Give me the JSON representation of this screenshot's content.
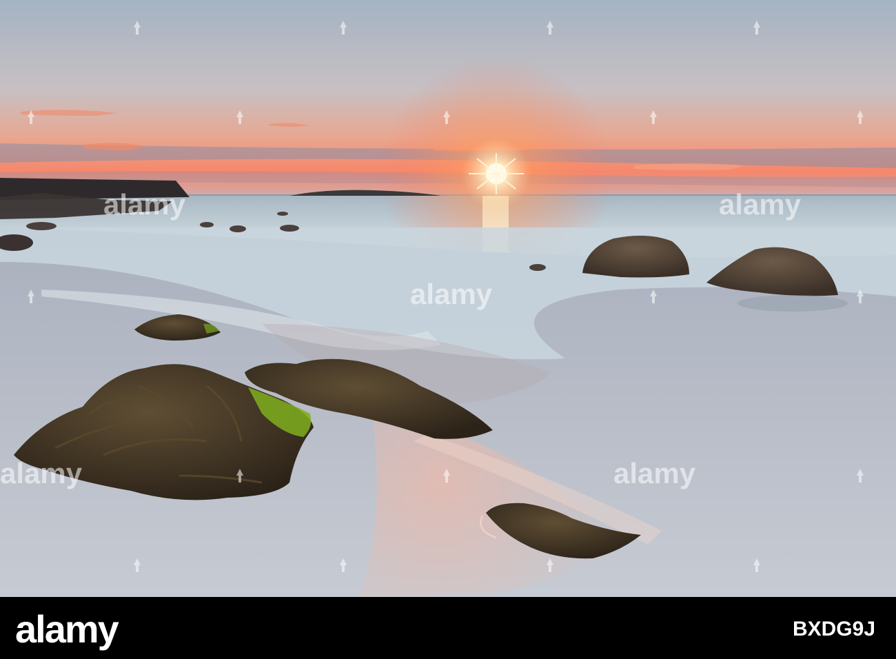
{
  "watermark": {
    "brand": "alamy",
    "mark_color": "#ffffff",
    "mark_opacity": 0.55
  },
  "footer": {
    "brand": "alamy",
    "image_id": "BXDG9J",
    "bg_color": "#000000",
    "text_color": "#ffffff"
  },
  "scene": {
    "subject": "sunset over sandy beach with seaweed-covered rocks",
    "sky_top": "#a7b7c6",
    "horizon_glow": "#f57e62",
    "sun_color": "#fff7d8",
    "sea_color": "#b9c9d2",
    "sand_color": "#b9bfca",
    "rock_color": "#3f3220",
    "seaweed_highlight": "#7fae1f"
  }
}
